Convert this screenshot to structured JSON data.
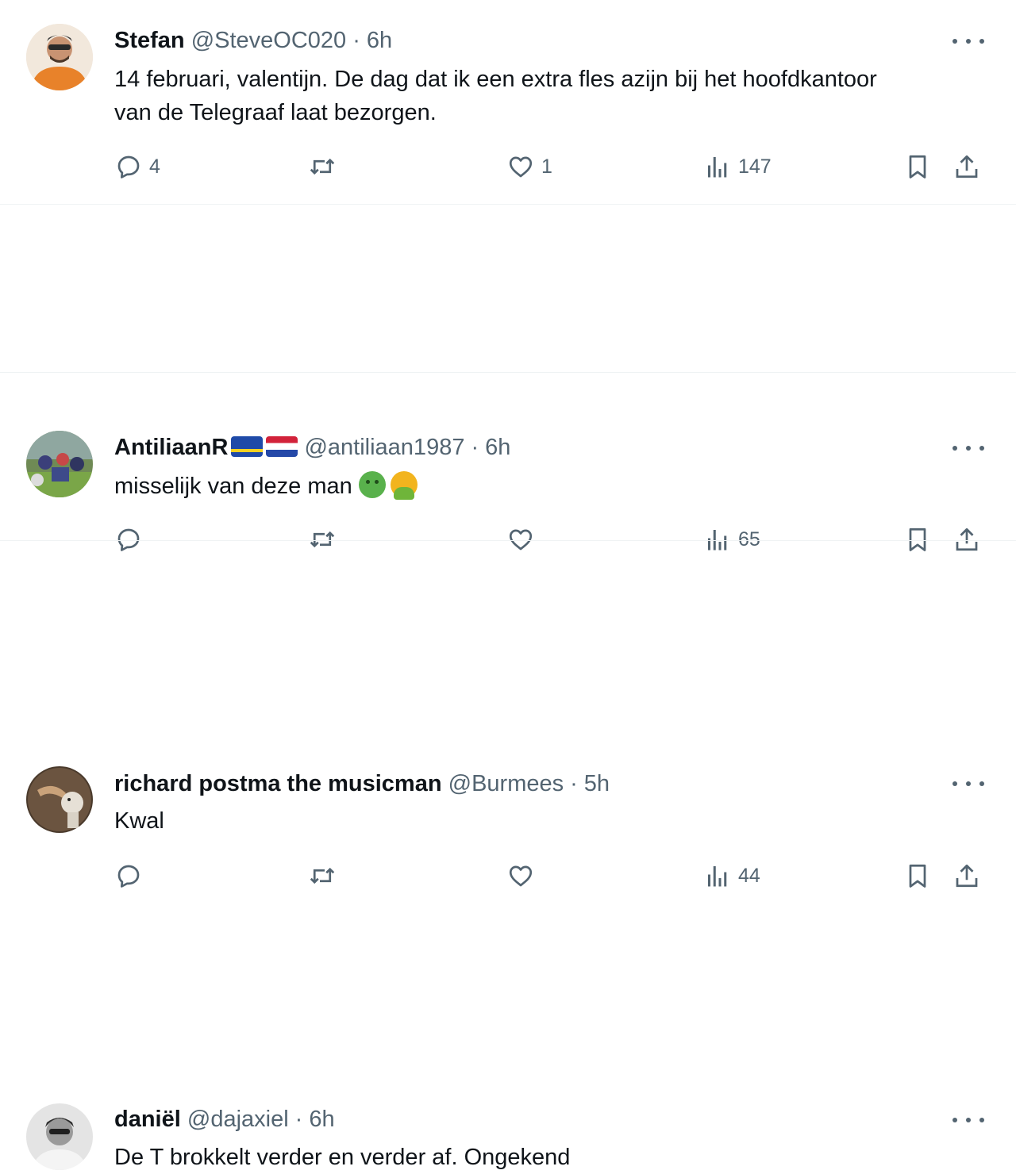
{
  "colors": {
    "text": "#0f1419",
    "muted": "#536471",
    "divider": "#eff3f4"
  },
  "tweets": [
    {
      "name": "Stefan",
      "handle": "@SteveOC020",
      "separator": "·",
      "time": "6h",
      "text_line1": "14 februari, valentijn. De dag dat ik een extra fles azijn bij het hoofdkantoor",
      "text_line2": "van de Telegraaf laat bezorgen.",
      "replies": "4",
      "likes": "1",
      "views": "147"
    },
    {
      "name": "AntiliaanR",
      "handle": "@antiliaan1987",
      "separator": "·",
      "time": "6h",
      "text": "misselijk van deze man",
      "replies": "",
      "likes": "",
      "views": "65"
    },
    {
      "name": "richard postma the musicman",
      "handle": "@Burmees",
      "separator": "·",
      "time": "5h",
      "text": "Kwal",
      "replies": "",
      "likes": "",
      "views": "44"
    },
    {
      "name": "daniël",
      "handle": "@dajaxiel",
      "separator": "·",
      "time": "6h",
      "text": "De T brokkelt verder en verder af. Ongekend"
    }
  ],
  "icons": {
    "reply": "reply-icon",
    "retweet": "retweet-icon",
    "like": "heart-icon",
    "views": "views-icon",
    "bookmark": "bookmark-icon",
    "share": "share-icon",
    "more": "more-icon"
  }
}
